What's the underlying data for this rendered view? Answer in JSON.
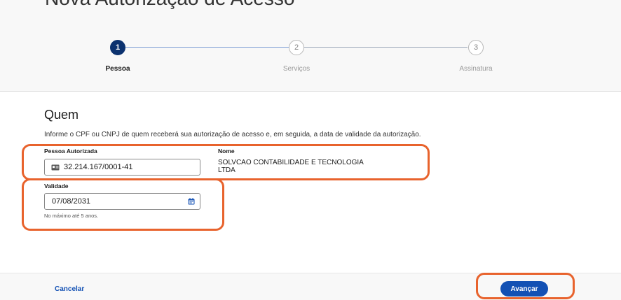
{
  "page": {
    "title": "Nova Autorização de Acesso"
  },
  "stepper": {
    "steps": [
      {
        "number": "1",
        "label": "Pessoa",
        "state": "active"
      },
      {
        "number": "2",
        "label": "Serviços",
        "state": "pending"
      },
      {
        "number": "3",
        "label": "Assinatura",
        "state": "pending"
      }
    ]
  },
  "section": {
    "title": "Quem",
    "instructions": "Informe o CPF ou CNPJ de quem receberá sua autorização de acesso e, em seguida, a data de validade da autorização."
  },
  "form": {
    "pessoa_label": "Pessoa Autorizada",
    "pessoa_value": "32.214.167/0001-41",
    "pessoa_icon": "id-card-icon",
    "nome_label": "Nome",
    "nome_line1": "SOLVCAO CONTABILIDADE E TECNOLOGIA",
    "nome_line2": "LTDA",
    "validade_label": "Validade",
    "validade_value": "07/08/2031",
    "validade_icon": "calendar-icon",
    "validade_hint": "No máximo até 5 anos."
  },
  "footer": {
    "cancel_label": "Cancelar",
    "advance_label": "Avançar"
  },
  "colors": {
    "primary": "#1351b4",
    "active_step": "#0c326f",
    "highlight": "#e8632d"
  }
}
